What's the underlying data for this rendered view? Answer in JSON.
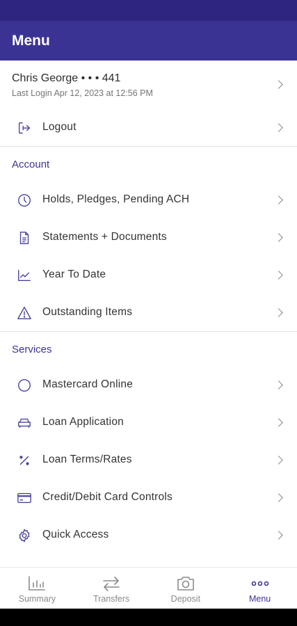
{
  "header": {
    "title": "Menu"
  },
  "user": {
    "name": "Chris George • • • 441",
    "last_login": "Last Login Apr 12, 2023 at 12:56 PM"
  },
  "logout": {
    "label": "Logout",
    "icon": "logout-icon"
  },
  "account": {
    "title": "Account",
    "items": [
      {
        "label": "Holds, Pledges, Pending ACH",
        "icon": "clock-icon"
      },
      {
        "label": "Statements + Documents",
        "icon": "document-icon"
      },
      {
        "label": "Year To Date",
        "icon": "line-chart-icon"
      },
      {
        "label": "Outstanding Items",
        "icon": "warning-icon"
      }
    ]
  },
  "services": {
    "title": "Services",
    "items": [
      {
        "label": "Mastercard Online",
        "icon": "circle-icon"
      },
      {
        "label": "Loan Application",
        "icon": "car-icon"
      },
      {
        "label": "Loan Terms/Rates",
        "icon": "percent-icon"
      },
      {
        "label": "Credit/Debit Card Controls",
        "icon": "card-icon"
      },
      {
        "label": "Quick Access",
        "icon": "gear-icon"
      }
    ]
  },
  "tabs": [
    {
      "label": "Summary",
      "icon": "bar-chart-icon",
      "active": false
    },
    {
      "label": "Transfers",
      "icon": "transfer-arrows-icon",
      "active": false
    },
    {
      "label": "Deposit",
      "icon": "camera-icon",
      "active": false
    },
    {
      "label": "Menu",
      "icon": "more-dots-icon",
      "active": true
    }
  ],
  "colors": {
    "brand": "#3b3394",
    "status_bar": "#2d2580",
    "icon": "#4a43a0",
    "inactive_tab": "#8a8a8a"
  }
}
